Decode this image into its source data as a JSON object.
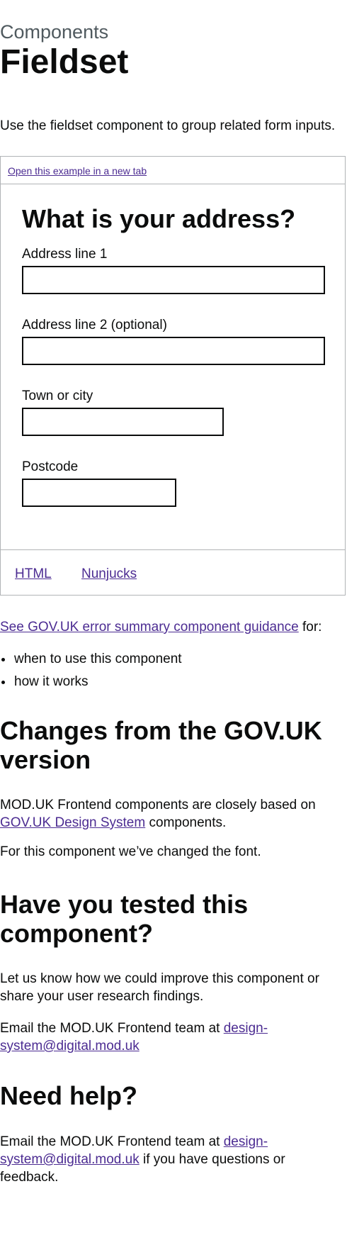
{
  "header": {
    "caption": "Components",
    "title": "Fieldset"
  },
  "intro": "Use the fieldset component to group related form inputs.",
  "example": {
    "open_link": "Open this example in a new tab",
    "legend": "What is your address?",
    "fields": [
      {
        "label": "Address line 1",
        "value": ""
      },
      {
        "label": "Address line 2 (optional)",
        "value": ""
      },
      {
        "label": "Town or city",
        "value": ""
      },
      {
        "label": "Postcode",
        "value": ""
      }
    ],
    "tabs": [
      "HTML",
      "Nunjucks"
    ]
  },
  "guidance": {
    "link_text": "See GOV.UK error summary component guidance",
    "suffix": " for:",
    "bullets": [
      "when to use this component",
      "how it works"
    ]
  },
  "changes": {
    "heading": "Changes from the GOV.UK version",
    "para1_prefix": "MOD.UK Frontend components are closely based on ",
    "para1_link": "GOV.UK Design System",
    "para1_suffix": " components.",
    "para2": "For this component we’ve changed the font."
  },
  "tested": {
    "heading": "Have you tested this component?",
    "para1": "Let us know how we could improve this component or share your user research findings.",
    "para2_prefix": "Email the MOD.UK Frontend team at ",
    "email_link": "design-system@digital.mod.uk"
  },
  "help": {
    "heading": "Need help?",
    "para_prefix": "Email the MOD.UK Frontend team at ",
    "email_link": "design-system@digital.mod.uk",
    "para_suffix": " if you have questions or feedback."
  },
  "colors": {
    "text": "#0b0c0c",
    "link": "#4c2c92",
    "secondary_text": "#505a5f",
    "border": "#b1b4b6"
  }
}
